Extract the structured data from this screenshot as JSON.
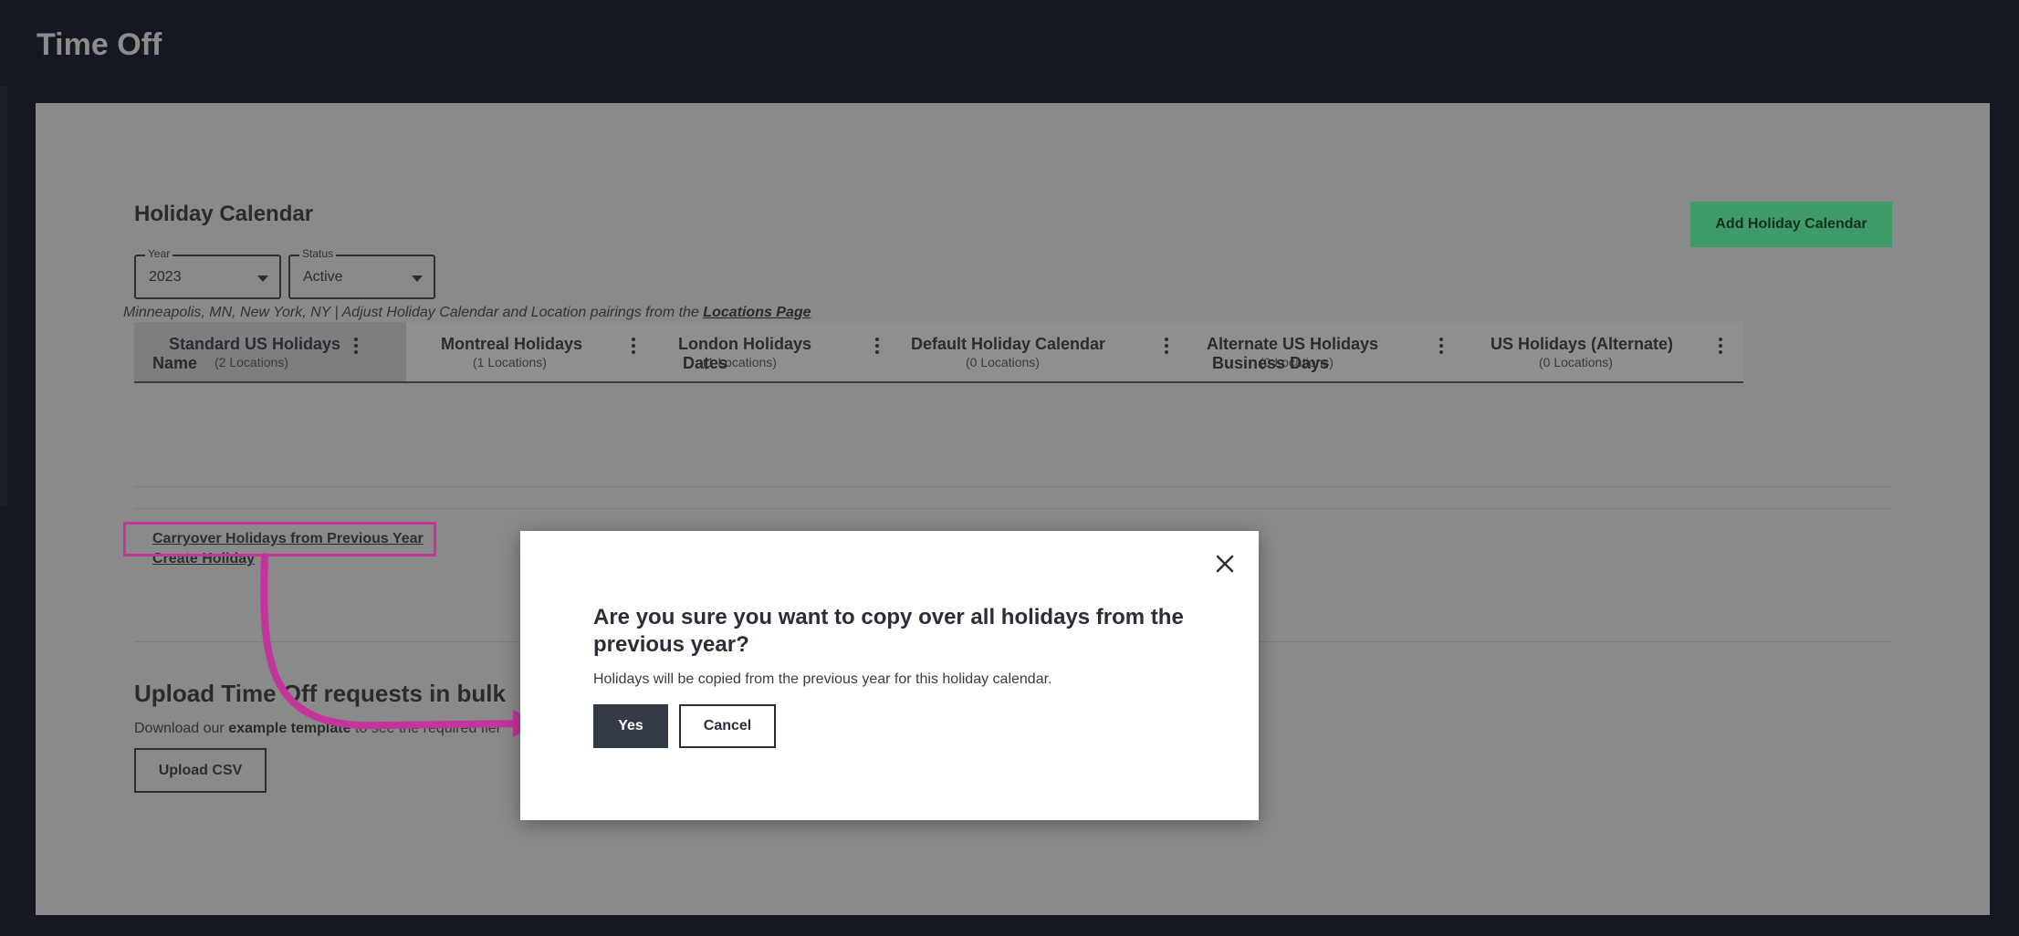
{
  "header": {
    "title": "Time Off"
  },
  "holiday_calendar": {
    "title": "Holiday Calendar",
    "add_button": "Add Holiday Calendar",
    "year": {
      "label": "Year",
      "value": "2023"
    },
    "status": {
      "label": "Status",
      "value": "Active"
    },
    "tabs": [
      {
        "name": "Standard US Holidays",
        "locations": "(2 Locations)"
      },
      {
        "name": "Montreal Holidays",
        "locations": "(1 Locations)"
      },
      {
        "name": "London Holidays",
        "locations": "(1 Locations)"
      },
      {
        "name": "Default Holiday Calendar",
        "locations": "(0 Locations)"
      },
      {
        "name": "Alternate US Holidays",
        "locations": "(0 Locations)"
      },
      {
        "name": "US Holidays (Alternate)",
        "locations": "(0 Locations)"
      }
    ],
    "locations_text": "Minneapolis, MN, New York, NY | Adjust Holiday Calendar and Location pairings from the",
    "locations_link": "Locations Page",
    "columns": [
      "Name",
      "Dates",
      "Business Days"
    ],
    "carryover_link": "Carryover Holidays from Previous Year",
    "create_link": "Create Holiday"
  },
  "upload": {
    "title": "Upload Time Off requests in bulk",
    "desc_prefix": "Download our",
    "desc_link": "example template",
    "desc_suffix": "to see the required fiel",
    "button": "Upload CSV"
  },
  "modal": {
    "title": "Are you sure you want to copy over all holidays from the previous year?",
    "message": "Holidays will be copied from the previous year for this holiday calendar.",
    "yes": "Yes",
    "cancel": "Cancel"
  },
  "colors": {
    "accent_green": "#3f9b68",
    "highlight_pink": "#c4359b",
    "modal_primary": "#343a45"
  }
}
